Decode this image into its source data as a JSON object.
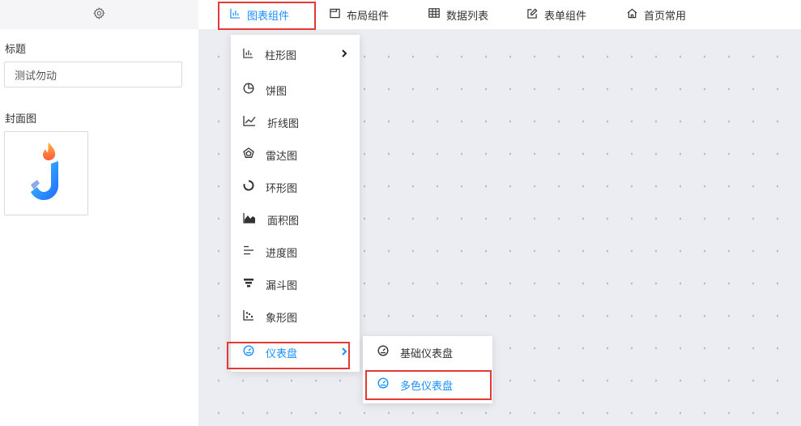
{
  "left_panel": {
    "title_label": "标题",
    "title_value": "测试勿动",
    "cover_label": "封面图"
  },
  "topnav": [
    {
      "label": "图表组件",
      "icon": "bar-chart-icon",
      "active": true
    },
    {
      "label": "布局组件",
      "icon": "layout-icon",
      "active": false
    },
    {
      "label": "数据列表",
      "icon": "table-icon",
      "active": false
    },
    {
      "label": "表单组件",
      "icon": "edit-form-icon",
      "active": false
    },
    {
      "label": "首页常用",
      "icon": "home-icon",
      "active": false
    }
  ],
  "menu": [
    {
      "label": "柱形图",
      "icon": "bar-chart-icon",
      "has_submenu": true
    },
    {
      "label": "饼图",
      "icon": "pie-chart-icon"
    },
    {
      "label": "折线图",
      "icon": "line-chart-icon"
    },
    {
      "label": "雷达图",
      "icon": "radar-chart-icon"
    },
    {
      "label": "环形图",
      "icon": "ring-chart-icon"
    },
    {
      "label": "面积图",
      "icon": "area-chart-icon"
    },
    {
      "label": "进度图",
      "icon": "progress-chart-icon"
    },
    {
      "label": "漏斗图",
      "icon": "funnel-chart-icon"
    },
    {
      "label": "象形图",
      "icon": "pictorial-chart-icon"
    },
    {
      "label": "仪表盘",
      "icon": "gauge-icon",
      "has_submenu": true,
      "active": true
    }
  ],
  "submenu": [
    {
      "label": "基础仪表盘",
      "icon": "gauge-icon"
    },
    {
      "label": "多色仪表盘",
      "icon": "gauge-icon",
      "active": true
    }
  ],
  "colors": {
    "accent": "#1890ff",
    "highlight_border": "#e53935",
    "canvas_bg": "#ebedf2"
  }
}
